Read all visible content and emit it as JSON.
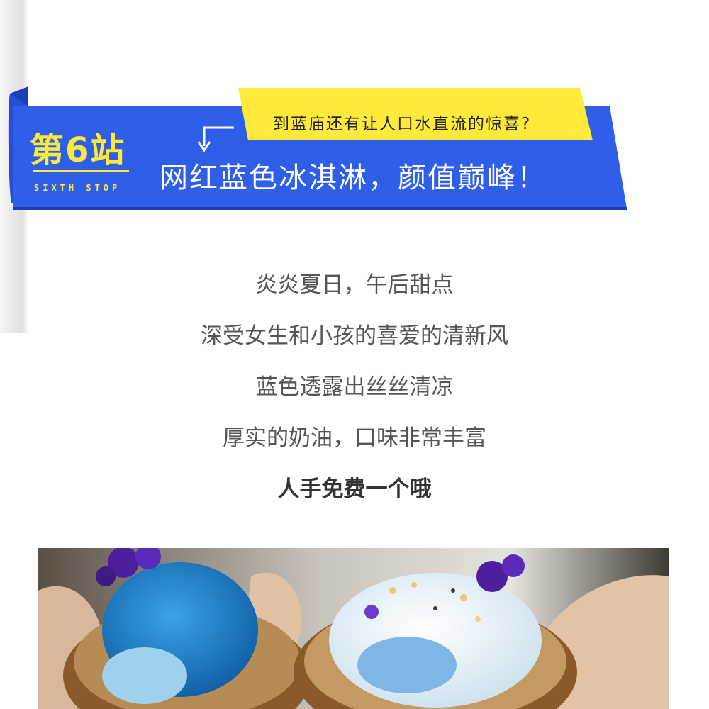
{
  "banner": {
    "stop_label": "第6站",
    "stop_label_en": "SIXTH STOP",
    "caption": "到蓝庙还有让人口水直流的惊喜?",
    "headline": "网红蓝色冰淇淋，颜值巅峰！"
  },
  "intro": {
    "lines": [
      "炎炎夏日，午后甜点",
      "深受女生和小孩的喜爱的清新风",
      "蓝色透露出丝丝清凉",
      "厚实的奶油，口味非常丰富",
      "人手免费一个哦"
    ]
  },
  "colors": {
    "banner_blue": "#2f5fe8",
    "banner_blue_dark": "#1b3fb8",
    "accent_yellow": "#ffe93b",
    "text_gray": "#555555",
    "text_dark": "#333333"
  }
}
